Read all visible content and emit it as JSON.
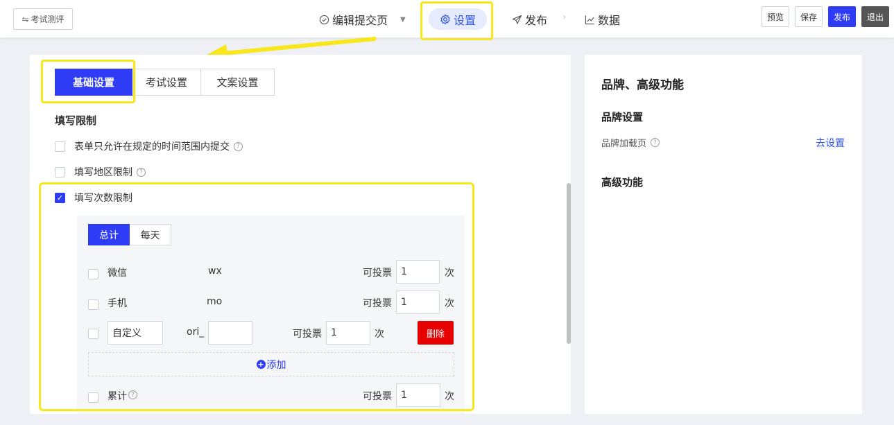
{
  "header": {
    "back_label": "考试测评",
    "back_icon": "swap-icon",
    "nav": {
      "edit": "编辑提交页",
      "settings": "设置",
      "publish": "发布",
      "separator": "›",
      "data": "数据"
    },
    "buttons": {
      "preview": "预览",
      "save": "保存",
      "publish": "发布",
      "exit": "退出"
    }
  },
  "colors": {
    "accent": "#2f3cf5",
    "highlight": "#f8e71c",
    "danger": "#e60000",
    "link": "#2f54eb"
  },
  "tabs": [
    "基础设置",
    "考试设置",
    "文案设置"
  ],
  "fill_limits": {
    "title": "填写限制",
    "items": [
      {
        "label": "表单只允许在规定的时间范围内提交",
        "checked": false,
        "help": "?"
      },
      {
        "label": "填写地区限制",
        "checked": false,
        "help": "?"
      },
      {
        "label": "填写次数限制",
        "checked": true
      }
    ]
  },
  "count_limit": {
    "subtabs": [
      "总计",
      "每天"
    ],
    "rows": [
      {
        "name": "微信",
        "key": "wx",
        "vote_label": "可投票",
        "value": "1",
        "unit": "次"
      },
      {
        "name": "手机",
        "key": "mo",
        "vote_label": "可投票",
        "value": "1",
        "unit": "次"
      }
    ],
    "custom": {
      "name_value": "自定义",
      "prefix": "ori_",
      "key_value": "",
      "vote_label": "可投票",
      "value": "1",
      "unit": "次",
      "delete_label": "删除"
    },
    "add_label": "添加",
    "total": {
      "name": "累计",
      "help": "?",
      "vote_label": "可投票",
      "value": "1",
      "unit": "次"
    }
  },
  "right_panel": {
    "title": "品牌、高级功能",
    "brand_title": "品牌设置",
    "brand_loading_label": "品牌加载页",
    "brand_help": "?",
    "brand_link": "去设置",
    "advanced_title": "高级功能"
  }
}
